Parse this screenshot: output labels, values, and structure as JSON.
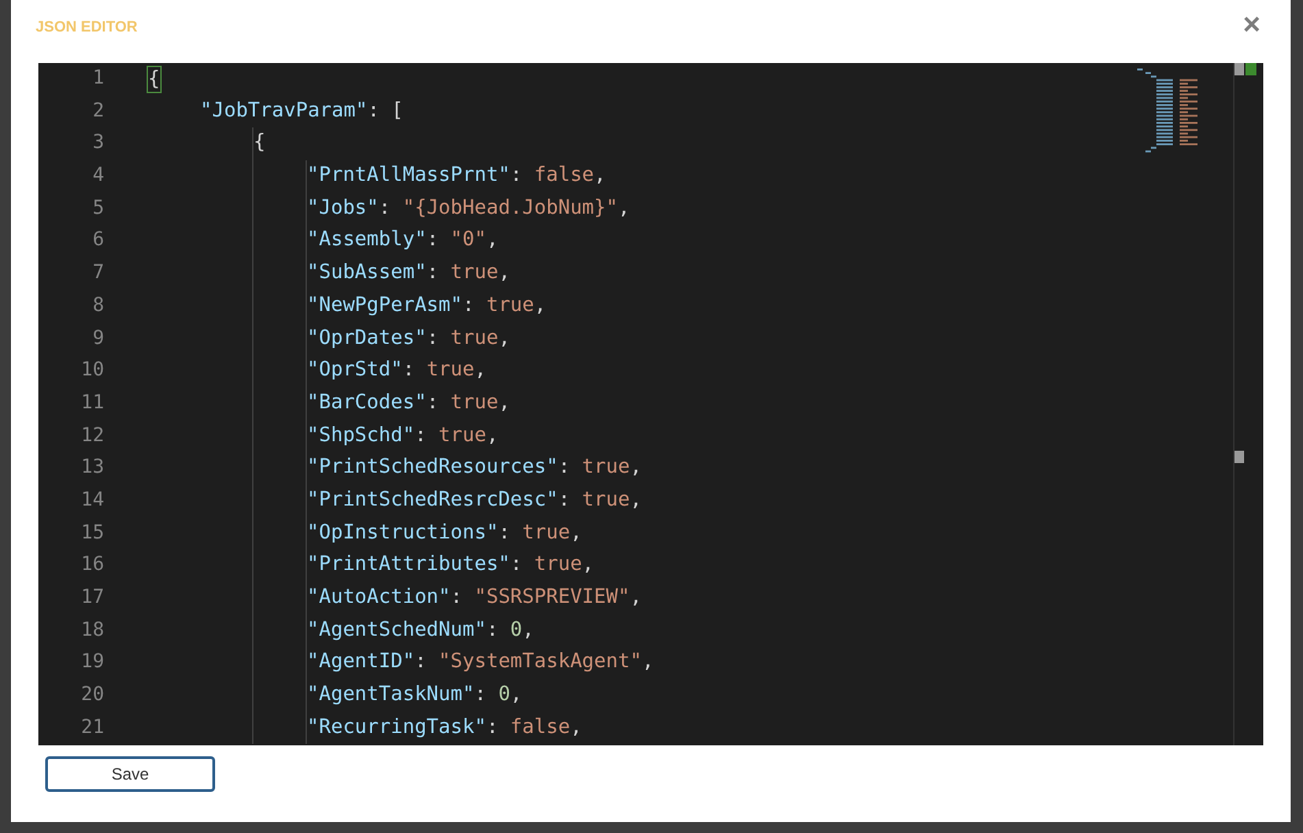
{
  "dialog": {
    "title": "JSON EDITOR",
    "close": "×"
  },
  "editor": {
    "lines": [
      {
        "number": "1",
        "tokens": [
          {
            "kind": "bracket",
            "text": "{"
          }
        ],
        "children": [
          {
            "number": "2",
            "tokens": [
              {
                "kind": "key",
                "text": "\"JobTravParam\""
              },
              {
                "kind": "punct",
                "text": ": ["
              }
            ],
            "children": [
              {
                "number": "3",
                "tokens": [
                  {
                    "kind": "punct",
                    "text": "{"
                  }
                ],
                "children": [
                  {
                    "number": "4",
                    "tokens": [
                      {
                        "kind": "key",
                        "text": "\"PrntAllMassPrnt\""
                      },
                      {
                        "kind": "punct",
                        "text": ": "
                      },
                      {
                        "kind": "literal",
                        "text": "false"
                      },
                      {
                        "kind": "punct",
                        "text": ","
                      }
                    ]
                  },
                  {
                    "number": "5",
                    "tokens": [
                      {
                        "kind": "key",
                        "text": "\"Jobs\""
                      },
                      {
                        "kind": "punct",
                        "text": ": "
                      },
                      {
                        "kind": "string",
                        "text": "\"{JobHead.JobNum}\""
                      },
                      {
                        "kind": "punct",
                        "text": ","
                      }
                    ]
                  },
                  {
                    "number": "6",
                    "tokens": [
                      {
                        "kind": "key",
                        "text": "\"Assembly\""
                      },
                      {
                        "kind": "punct",
                        "text": ": "
                      },
                      {
                        "kind": "string",
                        "text": "\"0\""
                      },
                      {
                        "kind": "punct",
                        "text": ","
                      }
                    ]
                  },
                  {
                    "number": "7",
                    "tokens": [
                      {
                        "kind": "key",
                        "text": "\"SubAssem\""
                      },
                      {
                        "kind": "punct",
                        "text": ": "
                      },
                      {
                        "kind": "literal",
                        "text": "true"
                      },
                      {
                        "kind": "punct",
                        "text": ","
                      }
                    ]
                  },
                  {
                    "number": "8",
                    "tokens": [
                      {
                        "kind": "key",
                        "text": "\"NewPgPerAsm\""
                      },
                      {
                        "kind": "punct",
                        "text": ": "
                      },
                      {
                        "kind": "literal",
                        "text": "true"
                      },
                      {
                        "kind": "punct",
                        "text": ","
                      }
                    ]
                  },
                  {
                    "number": "9",
                    "tokens": [
                      {
                        "kind": "key",
                        "text": "\"OprDates\""
                      },
                      {
                        "kind": "punct",
                        "text": ": "
                      },
                      {
                        "kind": "literal",
                        "text": "true"
                      },
                      {
                        "kind": "punct",
                        "text": ","
                      }
                    ]
                  },
                  {
                    "number": "10",
                    "tokens": [
                      {
                        "kind": "key",
                        "text": "\"OprStd\""
                      },
                      {
                        "kind": "punct",
                        "text": ": "
                      },
                      {
                        "kind": "literal",
                        "text": "true"
                      },
                      {
                        "kind": "punct",
                        "text": ","
                      }
                    ]
                  },
                  {
                    "number": "11",
                    "tokens": [
                      {
                        "kind": "key",
                        "text": "\"BarCodes\""
                      },
                      {
                        "kind": "punct",
                        "text": ": "
                      },
                      {
                        "kind": "literal",
                        "text": "true"
                      },
                      {
                        "kind": "punct",
                        "text": ","
                      }
                    ]
                  },
                  {
                    "number": "12",
                    "tokens": [
                      {
                        "kind": "key",
                        "text": "\"ShpSchd\""
                      },
                      {
                        "kind": "punct",
                        "text": ": "
                      },
                      {
                        "kind": "literal",
                        "text": "true"
                      },
                      {
                        "kind": "punct",
                        "text": ","
                      }
                    ]
                  },
                  {
                    "number": "13",
                    "tokens": [
                      {
                        "kind": "key",
                        "text": "\"PrintSchedResources\""
                      },
                      {
                        "kind": "punct",
                        "text": ": "
                      },
                      {
                        "kind": "literal",
                        "text": "true"
                      },
                      {
                        "kind": "punct",
                        "text": ","
                      }
                    ]
                  },
                  {
                    "number": "14",
                    "tokens": [
                      {
                        "kind": "key",
                        "text": "\"PrintSchedResrcDesc\""
                      },
                      {
                        "kind": "punct",
                        "text": ": "
                      },
                      {
                        "kind": "literal",
                        "text": "true"
                      },
                      {
                        "kind": "punct",
                        "text": ","
                      }
                    ]
                  },
                  {
                    "number": "15",
                    "tokens": [
                      {
                        "kind": "key",
                        "text": "\"OpInstructions\""
                      },
                      {
                        "kind": "punct",
                        "text": ": "
                      },
                      {
                        "kind": "literal",
                        "text": "true"
                      },
                      {
                        "kind": "punct",
                        "text": ","
                      }
                    ]
                  },
                  {
                    "number": "16",
                    "tokens": [
                      {
                        "kind": "key",
                        "text": "\"PrintAttributes\""
                      },
                      {
                        "kind": "punct",
                        "text": ": "
                      },
                      {
                        "kind": "literal",
                        "text": "true"
                      },
                      {
                        "kind": "punct",
                        "text": ","
                      }
                    ]
                  },
                  {
                    "number": "17",
                    "tokens": [
                      {
                        "kind": "key",
                        "text": "\"AutoAction\""
                      },
                      {
                        "kind": "punct",
                        "text": ": "
                      },
                      {
                        "kind": "string",
                        "text": "\"SSRSPREVIEW\""
                      },
                      {
                        "kind": "punct",
                        "text": ","
                      }
                    ]
                  },
                  {
                    "number": "18",
                    "tokens": [
                      {
                        "kind": "key",
                        "text": "\"AgentSchedNum\""
                      },
                      {
                        "kind": "punct",
                        "text": ": "
                      },
                      {
                        "kind": "number",
                        "text": "0"
                      },
                      {
                        "kind": "punct",
                        "text": ","
                      }
                    ]
                  },
                  {
                    "number": "19",
                    "tokens": [
                      {
                        "kind": "key",
                        "text": "\"AgentID\""
                      },
                      {
                        "kind": "punct",
                        "text": ": "
                      },
                      {
                        "kind": "string",
                        "text": "\"SystemTaskAgent\""
                      },
                      {
                        "kind": "punct",
                        "text": ","
                      }
                    ]
                  },
                  {
                    "number": "20",
                    "tokens": [
                      {
                        "kind": "key",
                        "text": "\"AgentTaskNum\""
                      },
                      {
                        "kind": "punct",
                        "text": ": "
                      },
                      {
                        "kind": "number",
                        "text": "0"
                      },
                      {
                        "kind": "punct",
                        "text": ","
                      }
                    ]
                  },
                  {
                    "number": "21",
                    "tokens": [
                      {
                        "kind": "key",
                        "text": "\"RecurringTask\""
                      },
                      {
                        "kind": "punct",
                        "text": ": "
                      },
                      {
                        "kind": "literal",
                        "text": "false"
                      },
                      {
                        "kind": "punct",
                        "text": ","
                      }
                    ]
                  }
                ]
              }
            ]
          }
        ]
      }
    ]
  },
  "buttons": [
    {
      "label": "Save"
    }
  ]
}
